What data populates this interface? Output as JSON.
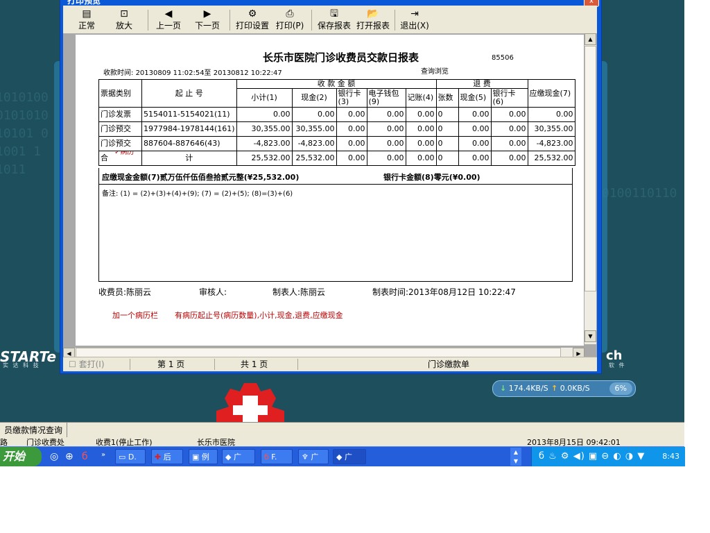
{
  "window": {
    "title": "打印预览",
    "close": "x"
  },
  "toolbar": {
    "items": [
      {
        "label": "正常",
        "icon": "▤"
      },
      {
        "label": "放大",
        "icon": "⊡"
      },
      {
        "label": "上一页",
        "icon": "◀"
      },
      {
        "label": "下一页",
        "icon": "▶"
      },
      {
        "label": "打印设置",
        "icon": "⚙"
      },
      {
        "label": "打印(P)",
        "icon": "⎙"
      },
      {
        "label": "保存报表",
        "icon": "🖫"
      },
      {
        "label": "打开报表",
        "icon": "📂"
      },
      {
        "label": "退出(X)",
        "icon": "⇥"
      }
    ]
  },
  "report": {
    "title": "长乐市医院门诊收费员交款日报表",
    "code": "85506",
    "time_label": "收款时间:",
    "time_range": "20130809 11:02:54至 20130812 10:22:47",
    "query_note": "查询浏览",
    "headers": {
      "type": "票据类别",
      "range": "起  止  号",
      "amount_group": "收  款  金  额",
      "refund_group": "退  费",
      "due": "应缴现金(7)",
      "subtotal": "小计(1)",
      "cash2": "现金(2)",
      "bankcard3": "银行卡(3)",
      "ewallet9": "电子钱包(9)",
      "account4": "记账(4)",
      "count": "张数",
      "cash5": "现金(5)",
      "bankcard6": "银行卡(6)"
    },
    "rows": [
      {
        "type": "门诊发票",
        "range": "5154011-5154021(11)",
        "subtotal": "0.00",
        "cash": "0.00",
        "bank": "0.00",
        "ewallet": "0.00",
        "account": "0.00",
        "count": "0",
        "rcash": "0.00",
        "rbank": "0.00",
        "due": "0.00"
      },
      {
        "type": "门诊预交",
        "range": "1977984-1978144(161)",
        "subtotal": "30,355.00",
        "cash": "30,355.00",
        "bank": "0.00",
        "ewallet": "0.00",
        "account": "0.00",
        "count": "0",
        "rcash": "0.00",
        "rbank": "0.00",
        "due": "30,355.00"
      },
      {
        "type": "门诊预交",
        "range": "887604-887646(43)",
        "subtotal": "-4,823.00",
        "cash": "-4,823.00",
        "bank": "0.00",
        "ewallet": "0.00",
        "account": "0.00",
        "count": "0",
        "rcash": "0.00",
        "rbank": "0.00",
        "due": "-4,823.00"
      }
    ],
    "total": {
      "label_left": "合",
      "label_right": "计",
      "handwritten": "✓病历",
      "subtotal": "25,532.00",
      "cash": "25,532.00",
      "bank": "0.00",
      "ewallet": "0.00",
      "account": "0.00",
      "count": "0",
      "rcash": "0.00",
      "rbank": "0.00",
      "due": "25,532.00"
    },
    "cash_due_line": "应缴现金金额(7)贰万伍仟伍佰叁拾贰元整(¥25,532.00)",
    "bank_line": "银行卡金额(8)零元(¥0.00)",
    "remark": "备注: (1) = (2)+(3)+(4)+(9); (7) = (2)+(5); (8)=(3)+(6)",
    "cashier": "收费员:陈丽云",
    "auditor": "审核人:",
    "maker": "制表人:陈丽云",
    "made_time": "制表时间:2013年08月12日 10:22:47",
    "annotation1": "加一个病历栏",
    "annotation2": "有病历起止号(病历数量),小计,现金,退费,应缴现金"
  },
  "statusbar": {
    "print_set": "套打(I)",
    "page": "第 1 页",
    "total_pages": "共 1 页",
    "doc_name": "门诊缴款单"
  },
  "desktop": {
    "binary_lines": [
      "1010100",
      "0101010",
      "10101 0",
      "1001 1",
      "1011"
    ],
    "binary_right": "0100110110",
    "logo_left": "STARTe",
    "logo_left_sub": "实 达 科 技",
    "logo_right": "ch",
    "logo_right_sub": "软 件"
  },
  "netmon": {
    "down": "174.4KB/S",
    "up": "0.0KB/S",
    "pct": "6%"
  },
  "appbar": {
    "tab": "员缴款情况查询",
    "row2": [
      "路",
      "门诊收费处",
      "收费1(停止工作)",
      "长乐市医院",
      "2013年8月15日 09:42:01"
    ]
  },
  "taskbar": {
    "start": "开始",
    "tasks": [
      "D.",
      "后",
      "例",
      "广",
      "F.",
      "广",
      "广"
    ],
    "clock": "8:43"
  }
}
